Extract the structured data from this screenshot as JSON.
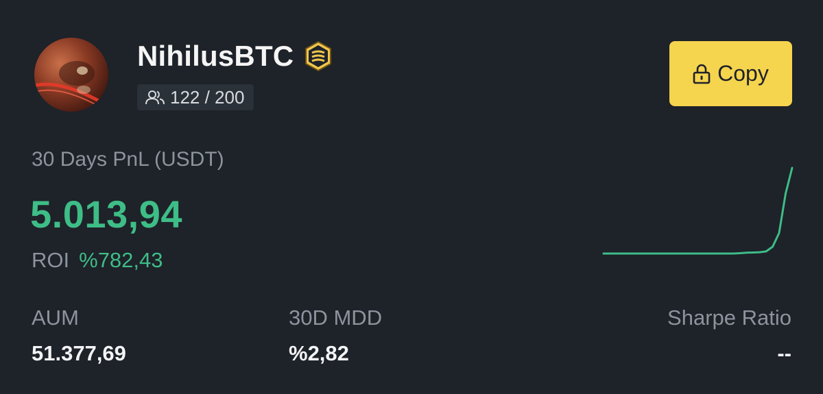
{
  "trader": {
    "name": "NihilusBTC",
    "badge_icon": "gold-badge-icon",
    "followers": "122 / 200"
  },
  "actions": {
    "copy_label": "Copy",
    "copy_icon": "lock-icon"
  },
  "pnl": {
    "label": "30 Days PnL (USDT)",
    "value": "5.013,94"
  },
  "roi": {
    "label": "ROI",
    "value": "%782,43"
  },
  "stats": [
    {
      "label": "AUM",
      "value": "51.377,69"
    },
    {
      "label": "30D MDD",
      "value": "%2,82"
    },
    {
      "label": "Sharpe Ratio",
      "value": "--"
    }
  ],
  "colors": {
    "background": "#1e2229",
    "positive": "#3ebd87",
    "accent": "#f5d44e",
    "muted": "#8d949e"
  },
  "chart_data": {
    "type": "line",
    "title": "",
    "series": [
      {
        "values": [
          0,
          0,
          0,
          0,
          0,
          0,
          0,
          0,
          0,
          0,
          0,
          0,
          0,
          0,
          0,
          0,
          0,
          0,
          0,
          0,
          0,
          0.4,
          1.0,
          1.2,
          1.5,
          2.5,
          8,
          24,
          70,
          100
        ]
      }
    ]
  }
}
